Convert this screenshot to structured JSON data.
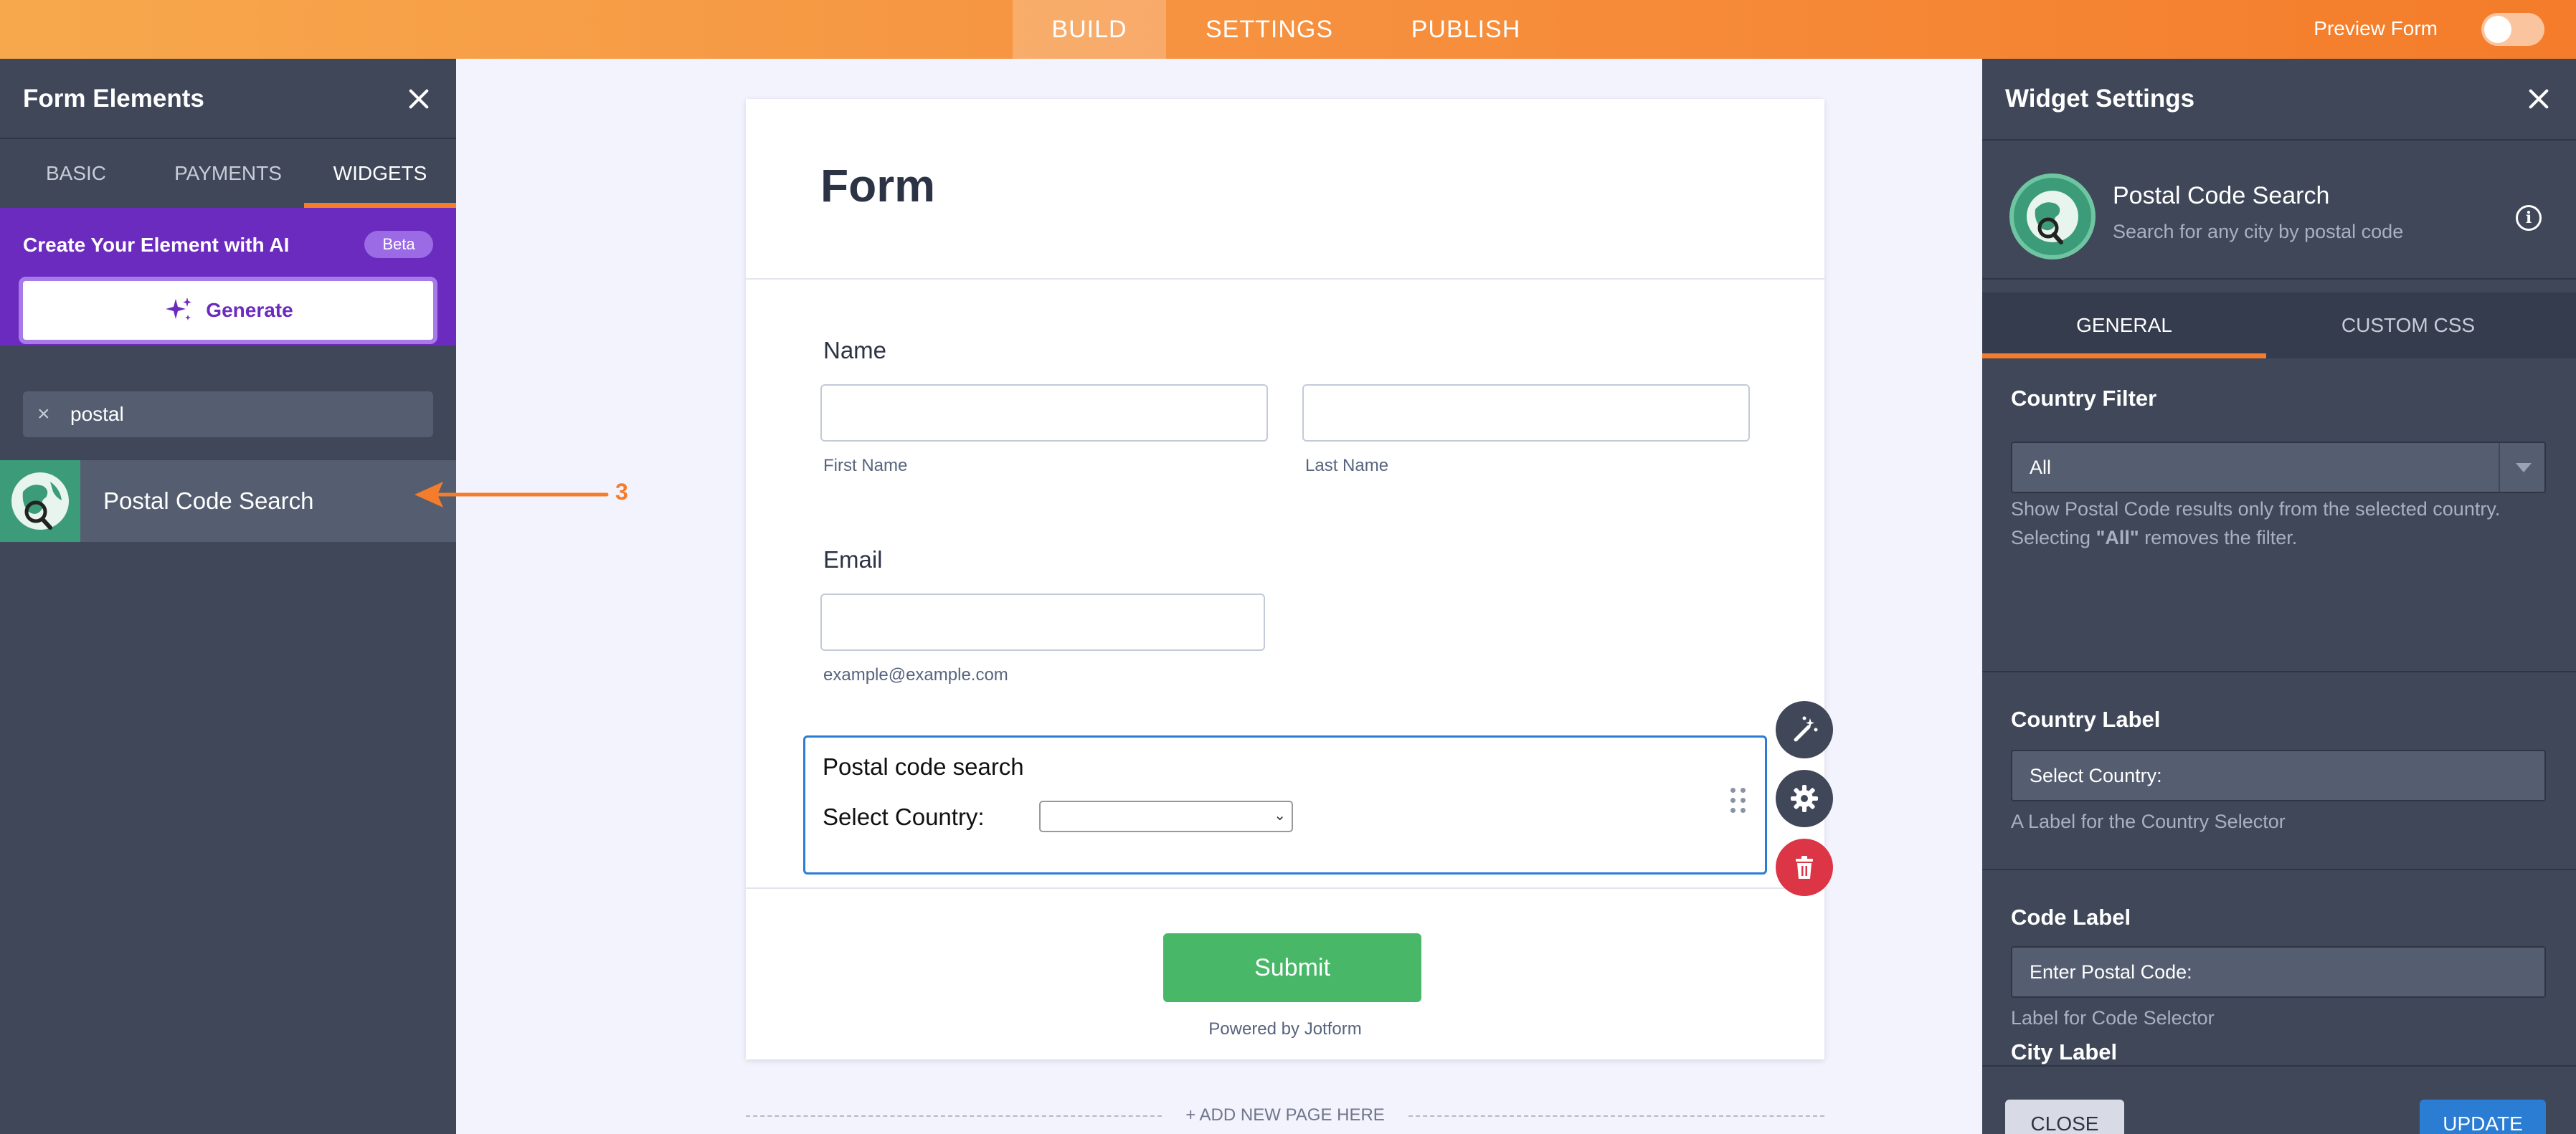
{
  "topbar": {
    "tabs": [
      {
        "label": "BUILD",
        "active": true
      },
      {
        "label": "SETTINGS",
        "active": false
      },
      {
        "label": "PUBLISH",
        "active": false
      }
    ],
    "preview_label": "Preview Form",
    "preview_on": false
  },
  "left_panel": {
    "title": "Form Elements",
    "tabs": [
      {
        "label": "BASIC",
        "active": false
      },
      {
        "label": "PAYMENTS",
        "active": false
      },
      {
        "label": "WIDGETS",
        "active": true
      }
    ],
    "ai": {
      "title": "Create Your Element with AI",
      "badge": "Beta",
      "button": "Generate"
    },
    "search": {
      "value": "postal"
    },
    "results": [
      {
        "label": "Postal Code Search"
      }
    ]
  },
  "annotation": {
    "number": "3"
  },
  "form": {
    "title": "Form",
    "name_label": "Name",
    "first_name_sub": "First Name",
    "last_name_sub": "Last Name",
    "email_label": "Email",
    "email_sub": "example@example.com",
    "postal": {
      "title": "Postal code search",
      "country_label": "Select Country:"
    },
    "submit": "Submit",
    "powered": "Powered by Jotform",
    "add_page": "+ ADD NEW PAGE HERE"
  },
  "right_panel": {
    "title": "Widget Settings",
    "widget": {
      "name": "Postal Code Search",
      "desc": "Search for any city by postal code"
    },
    "tabs": [
      {
        "label": "GENERAL",
        "active": true
      },
      {
        "label": "CUSTOM CSS",
        "active": false
      }
    ],
    "country_filter": {
      "title": "Country Filter",
      "value": "All",
      "note1": "Show Postal Code results only from the selected country.",
      "note2_prefix": "Selecting ",
      "note2_bold": "\"All\"",
      "note2_suffix": " removes the filter."
    },
    "country_label": {
      "title": "Country Label",
      "value": "Select Country:",
      "note": "A Label for the Country Selector"
    },
    "code_label": {
      "title": "Code Label",
      "value": "Enter Postal Code:",
      "note": "Label for Code Selector"
    },
    "city_label": {
      "title": "City Label"
    },
    "close_button": "CLOSE",
    "update_button": "UPDATE"
  },
  "colors": {
    "accent_orange": "#f47c2a",
    "selection_blue": "#2b7cd3",
    "submit_green": "#48b868",
    "ai_purple": "#6b2bbf",
    "delete_red": "#dc3545"
  }
}
